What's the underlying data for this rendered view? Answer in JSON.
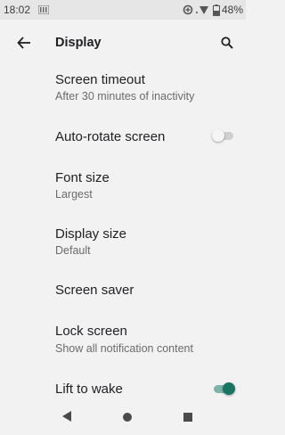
{
  "status": {
    "time": "18:02",
    "battery": "48%",
    "icons": [
      "sim-icon",
      "data-saver-icon",
      "wifi-icon",
      "battery-icon"
    ]
  },
  "app_bar": {
    "title": "Display",
    "back_icon": "back-arrow-icon",
    "search_icon": "search-icon"
  },
  "settings": [
    {
      "title": "Screen timeout",
      "subtitle": "After 30 minutes of inactivity"
    },
    {
      "title": "Auto-rotate screen",
      "toggle": false
    },
    {
      "title": "Font size",
      "subtitle": "Largest"
    },
    {
      "title": "Display size",
      "subtitle": "Default"
    },
    {
      "title": "Screen saver"
    },
    {
      "title": "Lock screen",
      "subtitle": "Show all notification content"
    },
    {
      "title": "Lift to wake",
      "toggle": true
    }
  ],
  "nav": {
    "icons": [
      "back-triangle-icon",
      "home-circle-icon",
      "recents-square-icon"
    ]
  },
  "colors": {
    "accent": "#1a7565",
    "toggle_off_track": "#cfcfcf",
    "toggle_off_thumb": "#f5f5f5",
    "background": "#f2f2f2"
  }
}
